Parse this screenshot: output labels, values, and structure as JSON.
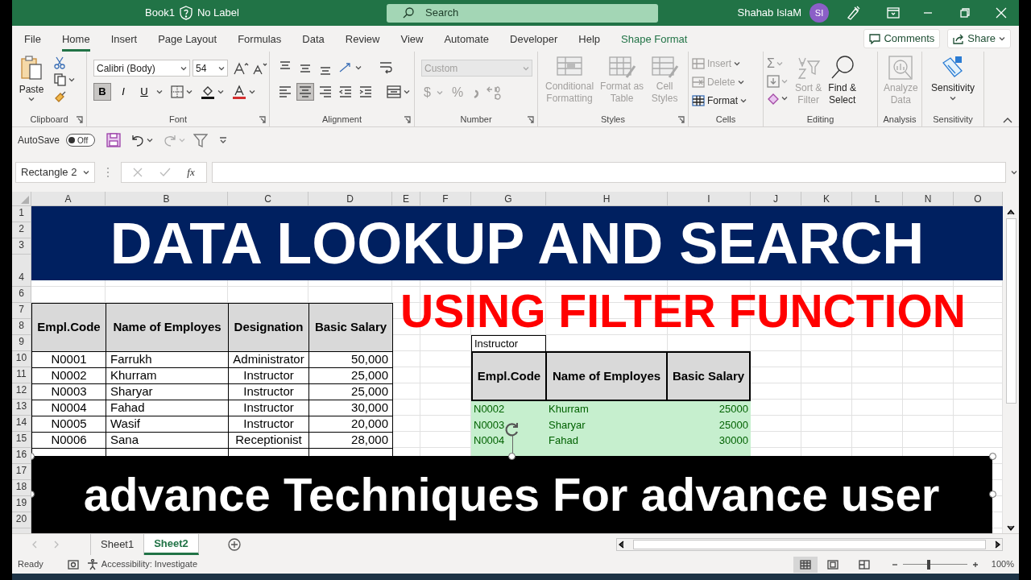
{
  "title_bar": {
    "file_name": "Book1",
    "label": "No Label",
    "search_placeholder": "Search",
    "user": "Shahab IslaM",
    "initials": "SI"
  },
  "menu_tabs": [
    {
      "label": "File",
      "selected": false,
      "contextual": false
    },
    {
      "label": "Home",
      "selected": true,
      "contextual": false
    },
    {
      "label": "Insert",
      "selected": false,
      "contextual": false
    },
    {
      "label": "Page Layout",
      "selected": false,
      "contextual": false
    },
    {
      "label": "Formulas",
      "selected": false,
      "contextual": false
    },
    {
      "label": "Data",
      "selected": false,
      "contextual": false
    },
    {
      "label": "Review",
      "selected": false,
      "contextual": false
    },
    {
      "label": "View",
      "selected": false,
      "contextual": false
    },
    {
      "label": "Automate",
      "selected": false,
      "contextual": false
    },
    {
      "label": "Developer",
      "selected": false,
      "contextual": false
    },
    {
      "label": "Help",
      "selected": false,
      "contextual": false
    },
    {
      "label": "Shape Format",
      "selected": false,
      "contextual": true
    }
  ],
  "header_buttons": [
    "Comments",
    "Share"
  ],
  "ribbon": {
    "clipboard": {
      "label": "Clipboard",
      "paste": "Paste"
    },
    "font": {
      "label": "Font",
      "font_name": "Calibri (Body)",
      "font_size": "54",
      "bold": {
        "text": "B",
        "selected": true
      },
      "italic": {
        "text": "I",
        "selected": false
      },
      "underline": {
        "text": "U",
        "selected": false
      }
    },
    "alignment": {
      "label": "Alignment"
    },
    "number": {
      "label": "Number",
      "format": "Custom",
      "format_disabled": true,
      "currency": "$",
      "percent": "%"
    },
    "styles": {
      "label": "Styles",
      "buttons": [
        {
          "lines": [
            "Conditional",
            "Formatting"
          ],
          "disabled": true
        },
        {
          "lines": [
            "Format as",
            "Table"
          ],
          "disabled": true
        },
        {
          "lines": [
            "Cell",
            "Styles"
          ],
          "disabled": true
        }
      ]
    },
    "cells": {
      "label": "Cells",
      "buttons": [
        {
          "label": "Insert",
          "disabled": true
        },
        {
          "label": "Delete",
          "disabled": true
        },
        {
          "label": "Format",
          "disabled": false
        }
      ]
    },
    "editing": {
      "label": "Editing",
      "autosum": "Σ",
      "buttons": [
        {
          "lines": [
            "Sort &",
            "Filter"
          ],
          "disabled": true
        },
        {
          "lines": [
            "Find &",
            "Select"
          ],
          "disabled": false
        }
      ]
    },
    "analysis": {
      "label": "Analysis",
      "buttons": [
        {
          "lines": [
            "Analyze",
            "Data"
          ],
          "disabled": true
        }
      ]
    },
    "sensitivity": {
      "label": "Sensitivity",
      "buttons": [
        {
          "lines": [
            "Sensitivity"
          ],
          "disabled": false
        }
      ]
    }
  },
  "quick_access": {
    "autosave_label": "AutoSave",
    "autosave": {
      "on": false,
      "text": "Off"
    }
  },
  "formula_bar": {
    "name_box": "Rectangle 2",
    "fx": "fx"
  },
  "column_headers": [
    "A",
    "B",
    "C",
    "D",
    "E",
    "F",
    "G",
    "H",
    "I",
    "J",
    "K",
    "L",
    "N",
    "O"
  ],
  "row_headers": [
    "1",
    "2",
    "3",
    "4",
    "6",
    "7",
    "8",
    "9",
    "10",
    "11",
    "12",
    "13",
    "14",
    "15",
    "16",
    "17",
    "18",
    "19",
    "20"
  ],
  "sheet": {
    "banner": "DATA LOOKUP AND SEARCH",
    "subtitle": "USING FILTER FUNCTION",
    "employees": {
      "columns": [
        "Empl.Code",
        "Name of Employes",
        "Designation",
        "Basic Salary"
      ],
      "rows": [
        [
          "N0001",
          "Farrukh",
          "Administrator",
          "50,000"
        ],
        [
          "N0002",
          "Khurram",
          "Instructor",
          "25,000"
        ],
        [
          "N0003",
          "Sharyar",
          "Instructor",
          "25,000"
        ],
        [
          "N0004",
          "Fahad",
          "Instructor",
          "30,000"
        ],
        [
          "N0005",
          "Wasif",
          "Instructor",
          "20,000"
        ],
        [
          "N0006",
          "Sana",
          "Receptionist",
          "28,000"
        ]
      ]
    },
    "criteria": "Instructor",
    "filtered": {
      "columns": [
        "Empl.Code",
        "Name of Employes",
        "Basic Salary"
      ],
      "rows": [
        [
          "N0002",
          "Khurram",
          "25000"
        ],
        [
          "N0003",
          "Sharyar",
          "25000"
        ],
        [
          "N0004",
          "Fahad",
          "30000"
        ]
      ]
    },
    "caption": "advance Techniques For advance user"
  },
  "sheet_tabs": [
    {
      "label": "Sheet1",
      "selected": false
    },
    {
      "label": "Sheet2",
      "selected": true
    }
  ],
  "status_bar": {
    "ready": "Ready",
    "accessibility": "Accessibility: Investigate",
    "zoom": "100%",
    "zoom_slider": {
      "level": 0.4
    }
  }
}
